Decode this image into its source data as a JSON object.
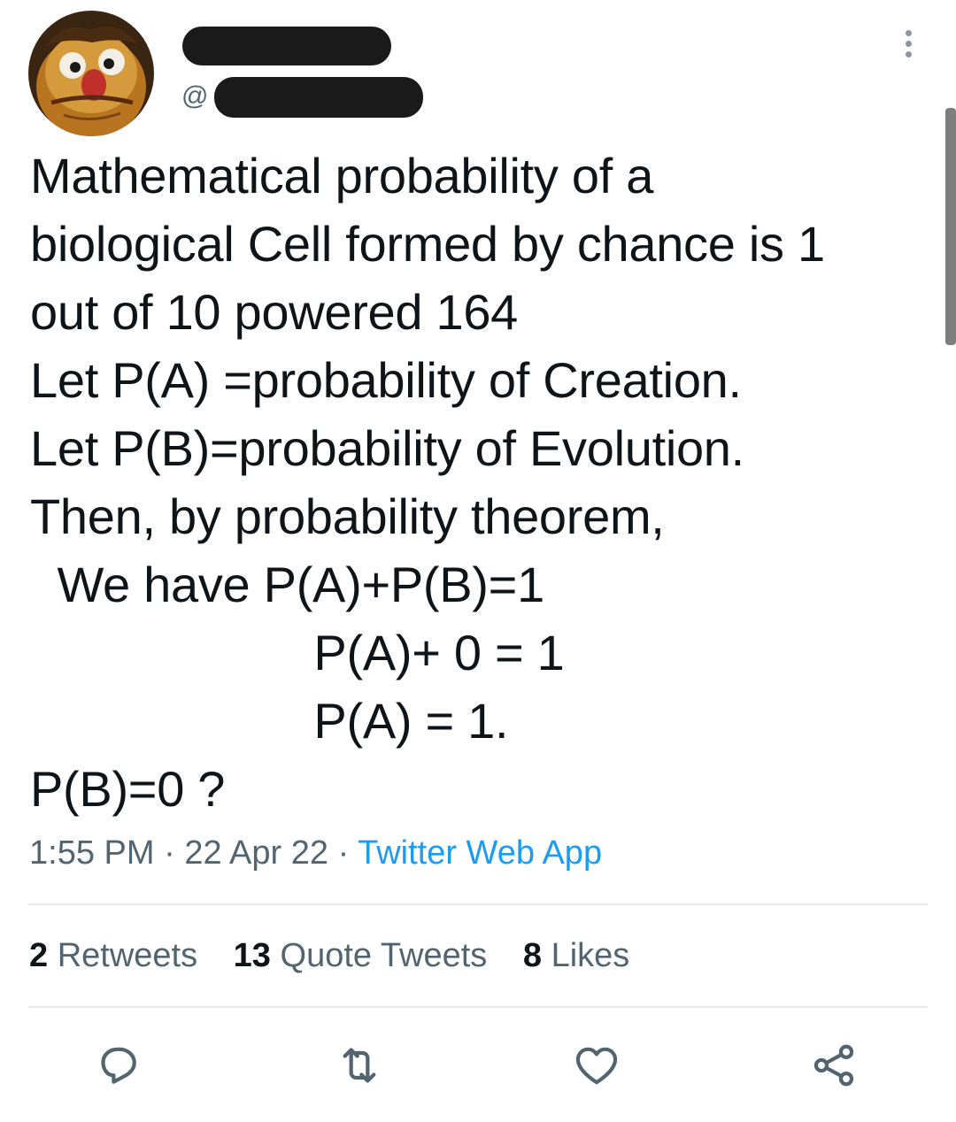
{
  "author": {
    "handle_prefix": "@"
  },
  "tweet": {
    "text": "Mathematical probability of a\nbiological Cell formed by chance is 1\nout of 10 powered 164\nLet P(A) =probability of Creation.\nLet P(B)=probability of Evolution.\nThen, by probability theorem,\n  We have P(A)+P(B)=1\n                     P(A)+ 0 = 1\n                     P(A) = 1.\nP(B)=0 ?",
    "time": "1:55 PM",
    "separator": "·",
    "date": "22 Apr 22",
    "source": "Twitter Web App"
  },
  "stats": {
    "retweets_count": "2",
    "retweets_label": "Retweets",
    "quotes_count": "13",
    "quotes_label": "Quote Tweets",
    "likes_count": "8",
    "likes_label": "Likes"
  },
  "actions": {
    "reply_icon": "reply-icon",
    "retweet_icon": "retweet-icon",
    "like_icon": "heart-icon",
    "share_icon": "share-icon"
  },
  "colors": {
    "link": "#1d9bf0",
    "muted": "#536471",
    "text": "#0f1419",
    "icon": "#536471"
  }
}
